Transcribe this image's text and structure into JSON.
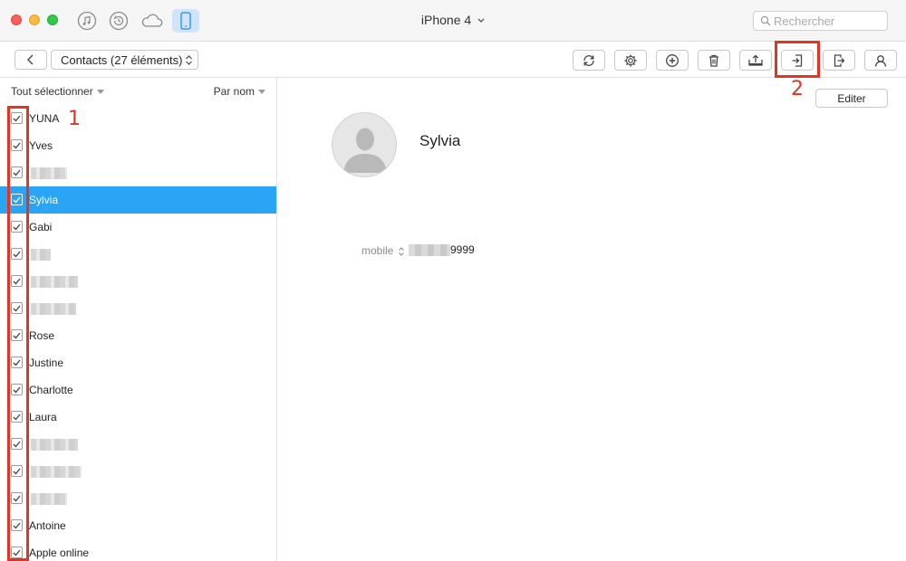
{
  "window": {
    "device_title": "iPhone 4",
    "search_placeholder": "Rechercher"
  },
  "toolbar": {
    "category_select": "Contacts (27 éléments)",
    "buttons": [
      "refresh-icon",
      "gear-icon",
      "plus-circle-icon",
      "trash-icon",
      "export-to-computer-icon",
      "import-to-device-icon",
      "export-to-device-icon",
      "contact-icon"
    ]
  },
  "list": {
    "select_all_label": "Tout sélectionner",
    "sort_label": "Par nom",
    "items": [
      {
        "name": "YUNA",
        "checked": true
      },
      {
        "name": "Yves",
        "checked": true
      },
      {
        "name": "",
        "checked": true
      },
      {
        "name": "Sylvia",
        "checked": true,
        "selected": true
      },
      {
        "name": "Gabi",
        "checked": true
      },
      {
        "name": "",
        "checked": true
      },
      {
        "name": "",
        "checked": true
      },
      {
        "name": "",
        "checked": true
      },
      {
        "name": "Rose",
        "checked": true
      },
      {
        "name": "Justine",
        "checked": true
      },
      {
        "name": "Charlotte",
        "checked": true
      },
      {
        "name": "Laura",
        "checked": true
      },
      {
        "name": "",
        "checked": true
      },
      {
        "name": "",
        "checked": true
      },
      {
        "name": "",
        "checked": true
      },
      {
        "name": "Antoine",
        "checked": true
      },
      {
        "name": "Apple online",
        "checked": true
      }
    ]
  },
  "annotations": {
    "marker_1": "1",
    "marker_2": "2",
    "color": "#e5331f"
  },
  "detail": {
    "edit_label": "Editer",
    "contact_name": "Sylvia",
    "phone_label": "mobile",
    "phone_value": "9999"
  },
  "colors": {
    "selection": "#2aa5f6",
    "active_tab_bg": "#cfe3fb"
  }
}
